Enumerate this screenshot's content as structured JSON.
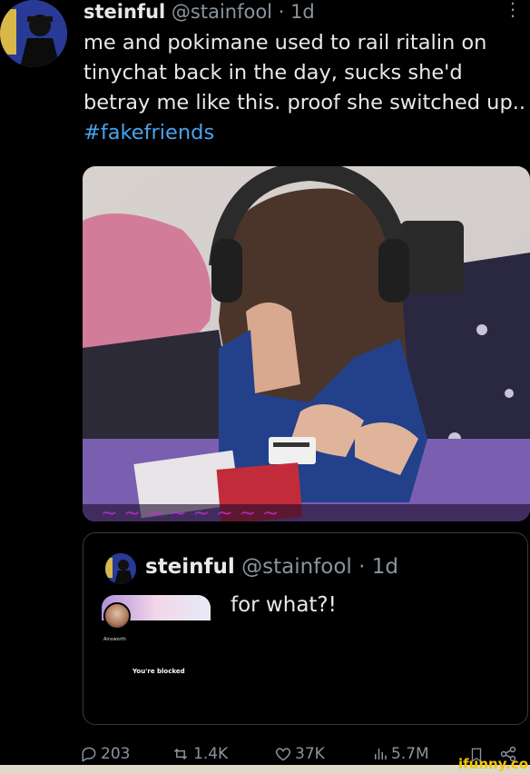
{
  "tweet": {
    "display_name": "steinful",
    "handle": "@stainfool",
    "separator": " · ",
    "time": "1d",
    "more": "⋮",
    "text_plain": "me and pokimane used to rail ritalin on tinychat back in the day, sucks she'd betray me like this. proof she switched up.. ",
    "hashtag": "#fakefriends"
  },
  "quote": {
    "display_name": "steinful",
    "handle": "@stainfool",
    "separator": " · ",
    "time": "1d",
    "text": "for what?!",
    "embedded_profile_name": "Ainsworth",
    "embedded_blocked_text": "You're blocked"
  },
  "actions": {
    "replies": "203",
    "reposts": "1.4K",
    "likes": "37K",
    "views": "5.7M"
  },
  "watermark": {
    "brand": "ifunny.co"
  },
  "colors": {
    "background": "#000000",
    "text": "#e7e9ea",
    "secondary": "#8b949e",
    "hashtag": "#4aa3ec",
    "watermark": "#f5c500"
  },
  "icons": [
    "more-icon",
    "reply-icon",
    "repost-icon",
    "like-icon",
    "views-icon",
    "bookmark-icon",
    "share-icon"
  ]
}
